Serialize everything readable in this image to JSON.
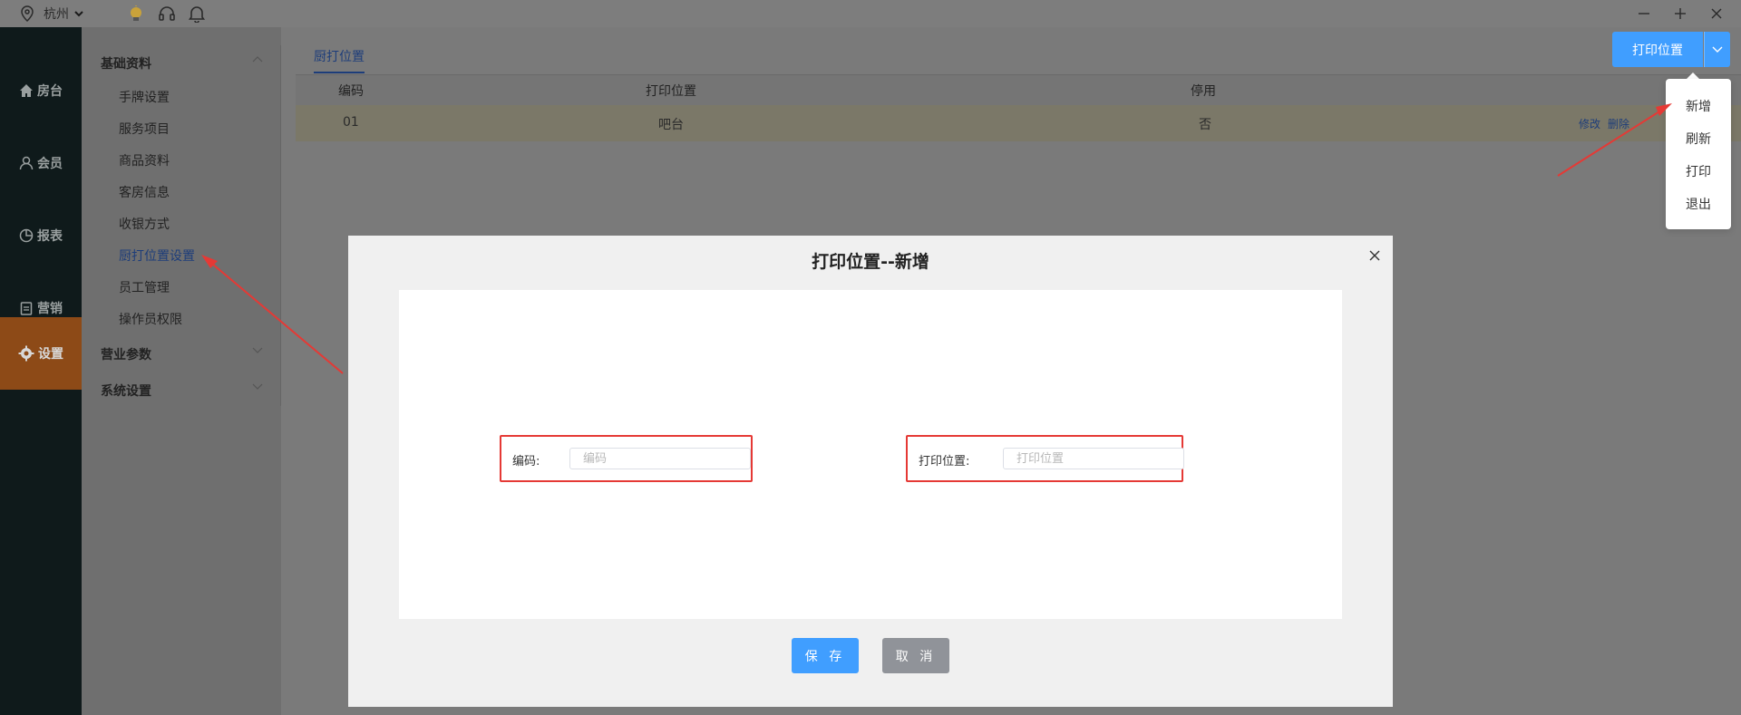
{
  "topbar": {
    "city": "杭州"
  },
  "nav": {
    "items": [
      {
        "label": "房台",
        "icon": "home-icon"
      },
      {
        "label": "会员",
        "icon": "user-icon"
      },
      {
        "label": "报表",
        "icon": "pie-chart-icon"
      },
      {
        "label": "营销",
        "icon": "clipboard-icon"
      },
      {
        "label": "设置",
        "icon": "gear-icon"
      }
    ],
    "active": "设置"
  },
  "menu": {
    "groups": [
      {
        "label": "基础资料",
        "expanded": true,
        "items": [
          "手牌设置",
          "服务项目",
          "商品资料",
          "客房信息",
          "收银方式",
          "厨打位置设置",
          "员工管理",
          "操作员权限"
        ]
      },
      {
        "label": "营业参数",
        "expanded": false
      },
      {
        "label": "系统设置",
        "expanded": false
      }
    ],
    "active_item": "厨打位置设置"
  },
  "content": {
    "tab": "厨打位置",
    "table": {
      "headers": [
        "编码",
        "打印位置",
        "停用"
      ],
      "rows": [
        {
          "code": "01",
          "location": "吧台",
          "disabled": "否",
          "edit": "修改",
          "delete": "删除"
        }
      ]
    },
    "print_button": "打印位置",
    "dropdown": [
      "新增",
      "刷新",
      "打印",
      "退出"
    ]
  },
  "modal": {
    "title": "打印位置--新增",
    "fields": [
      {
        "label": "编码:",
        "placeholder": "编码",
        "value": ""
      },
      {
        "label": "打印位置:",
        "placeholder": "打印位置",
        "value": ""
      }
    ],
    "save": "保 存",
    "cancel": "取 消"
  },
  "colors": {
    "primary": "#409eff",
    "highlight": "#e53935",
    "nav_active": "#8d4a17",
    "nav_bg": "#0f1a1b"
  }
}
